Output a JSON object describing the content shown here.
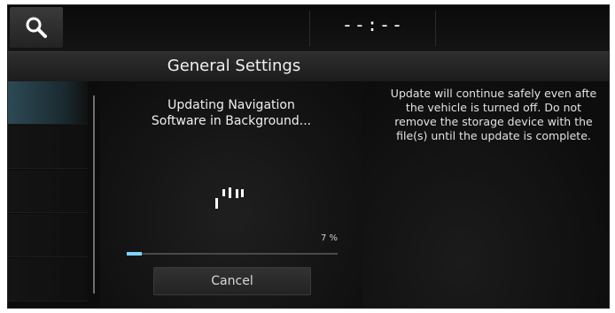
{
  "topbar": {
    "search_icon": "search-icon",
    "clock": "--:--"
  },
  "header": {
    "title": "General Settings"
  },
  "popup": {
    "message_line1": "Updating Navigation",
    "message_line2": "Software in Background...",
    "spinner_icon": "loading-spinner-icon",
    "progress_label": "7 %",
    "progress_fraction": 0.07,
    "cancel_label": "Cancel"
  },
  "info": {
    "lines": [
      "Update will continue safely even afte",
      "the vehicle is turned off. Do not",
      "remove the storage device with the",
      "file(s) until the update is complete."
    ]
  },
  "colors": {
    "accent": "#7fd3ff",
    "selected_menu": "#2d4a55",
    "background": "#050505"
  }
}
